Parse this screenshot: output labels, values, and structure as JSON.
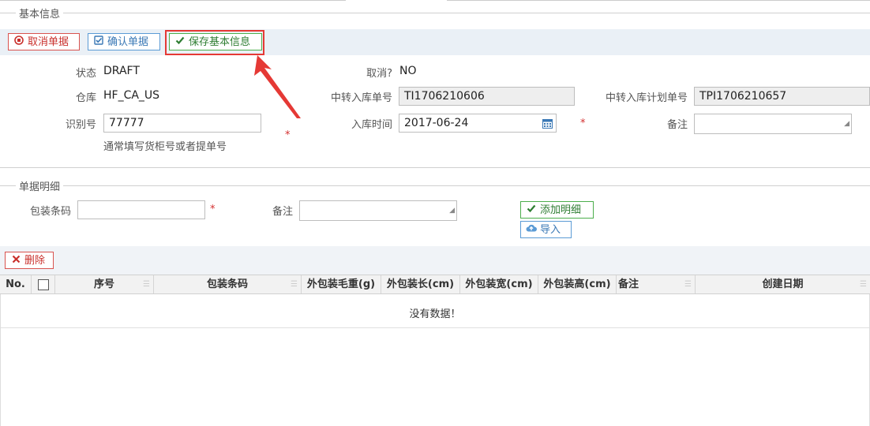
{
  "section_basic": {
    "legend": "基本信息"
  },
  "toolbar": {
    "cancel_label": "取消单据",
    "confirm_label": "确认单据",
    "save_label": "保存基本信息"
  },
  "basic": {
    "status_label": "状态",
    "status_value": "DRAFT",
    "cancelled_label": "取消?",
    "cancelled_value": "NO",
    "warehouse_label": "仓库",
    "warehouse_value": "HF_CA_US",
    "transfer_no_label": "中转入库单号",
    "transfer_no_value": "TI1706210606",
    "transfer_plan_label": "中转入库计划单号",
    "transfer_plan_value": "TPI1706210657",
    "id_label": "识别号",
    "id_value": "77777",
    "id_hint": "通常填写货柜号或者提单号",
    "inbound_time_label": "入库时间",
    "inbound_time_value": "2017-06-24",
    "remark_label": "备注",
    "remark_value": "",
    "required_mark": "*"
  },
  "section_detail": {
    "legend": "单据明细"
  },
  "detail_form": {
    "barcode_label": "包装条码",
    "barcode_value": "",
    "remark_label": "备注",
    "remark_value": "",
    "add_label": "添加明细",
    "import_label": "导入"
  },
  "grid": {
    "delete_label": "删除",
    "columns": [
      "No.",
      "",
      "序号",
      "包装条码",
      "外包装毛重(g)",
      "外包装长(cm)",
      "外包装宽(cm)",
      "外包装高(cm)",
      "备注",
      "创建日期"
    ],
    "empty_text": "没有数据！"
  },
  "icons": {
    "cancel": "stop-circle-icon",
    "confirm": "check-square-icon",
    "save": "check-icon",
    "calendar": "calendar-icon",
    "add": "check-icon",
    "import": "cloud-upload-icon",
    "delete": "times-icon"
  },
  "colors": {
    "danger": "#d9534f",
    "primary": "#5b9bd5",
    "success": "#4cae4c",
    "annotation": "#e53935"
  }
}
